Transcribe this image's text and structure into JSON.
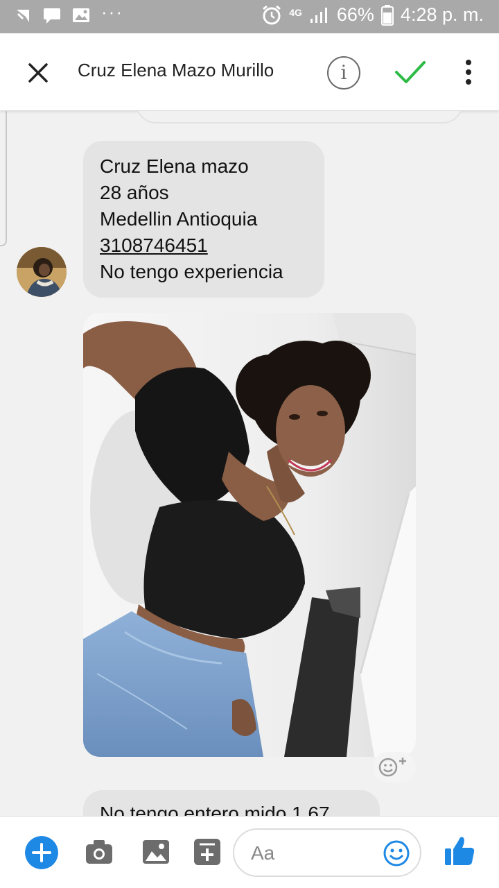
{
  "status_bar": {
    "left_icons": [
      "signal-arrow-icon",
      "chat-bubble-icon",
      "image-icon",
      "more-dots-icon"
    ],
    "more_dots": "···",
    "network": "4G",
    "battery": "66%",
    "time": "4:28 p. m."
  },
  "header": {
    "title": "Cruz Elena Mazo Murillo",
    "info_glyph": "i",
    "icons": [
      "close-icon",
      "info-icon",
      "checkmark-icon",
      "more-vert-icon"
    ],
    "accent_color": "#2dbb45"
  },
  "messages": [
    {
      "type": "text",
      "lines": [
        "Cruz Elena mazo",
        "28 años",
        "Medellin Antioquia",
        "3108746451",
        "No tengo experiencia"
      ]
    },
    {
      "type": "image"
    },
    {
      "type": "text",
      "lines": [
        "No tengo entero mido 1,67"
      ]
    }
  ],
  "composer": {
    "placeholder": "Aa",
    "icons": [
      "plus-icon",
      "camera-icon",
      "gallery-icon",
      "sticker-icon",
      "emoji-icon",
      "like-icon"
    ],
    "accent_color": "#1e88e5"
  }
}
